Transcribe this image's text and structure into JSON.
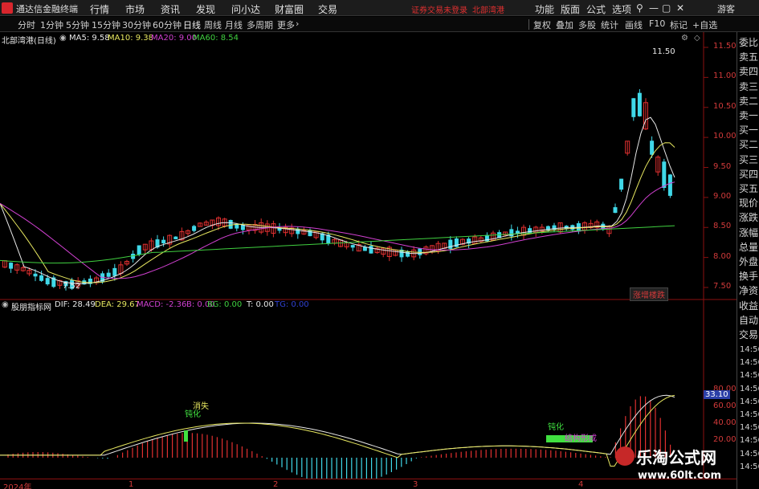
{
  "titlebar": {
    "app_name": "通达信金融终端",
    "menu": [
      "行情",
      "市场",
      "资讯",
      "发现",
      "问小达",
      "财富圈",
      "交易"
    ],
    "notice": "证券交易未登录",
    "stock_short": "北部湾港",
    "right_menu": [
      "功能",
      "版面",
      "公式",
      "选项"
    ],
    "guest": "游客"
  },
  "toolbar": {
    "periods": [
      "分时",
      "1分钟",
      "5分钟",
      "15分钟",
      "30分钟",
      "60分钟",
      "日线",
      "周线",
      "月线",
      "多周期",
      "更多"
    ],
    "active_period": "日线",
    "tools": [
      "复权",
      "叠加",
      "多股",
      "统计",
      "画线",
      "F10",
      "标记",
      "+自选"
    ]
  },
  "main_chart": {
    "title": "北部湾港(日线)",
    "ma_labels": [
      {
        "text": "MA5: 9.58",
        "color": "#e8e8e8"
      },
      {
        "text": "MA10: 9.38",
        "color": "#e8e860"
      },
      {
        "text": "MA20: 9.00",
        "color": "#d040d0"
      },
      {
        "text": "MA60: 8.54",
        "color": "#40d040"
      }
    ],
    "price_ticks": [
      "11.50",
      "11.00",
      "10.50",
      "10.00",
      "9.50",
      "9.00",
      "8.50",
      "8.00",
      "7.50"
    ],
    "high_label": "11.50",
    "low_label": "7.52",
    "tag": "涨增楼跌"
  },
  "sub_chart": {
    "title": "股朋指标网",
    "labels": [
      {
        "text": "DIF: 28.49",
        "color": "#e8e8e8"
      },
      {
        "text": "DEA: 29.67",
        "color": "#e8e860"
      },
      {
        "text": "MACD: -2.36",
        "color": "#d040d0"
      },
      {
        "text": "B: 0.00",
        "color": "#d040d0"
      },
      {
        "text": "BG: 0.00",
        "color": "#40d040"
      },
      {
        "text": "T: 0.00",
        "color": "#e8e8e8"
      },
      {
        "text": "TG: 0.00",
        "color": "#3040d0"
      }
    ],
    "ticks": [
      "80.00",
      "60.00",
      "40.00",
      "20.00"
    ],
    "value_box": "33.10",
    "annotations": [
      {
        "text": "消失",
        "color": "#e8e860"
      },
      {
        "text": "钝化",
        "color": "#40e040"
      },
      {
        "text": "钝化",
        "color": "#40e040"
      },
      {
        "text": "结构形成",
        "color": "#d040d0"
      }
    ]
  },
  "right_panel": {
    "labels": [
      "委比",
      "卖五",
      "卖四",
      "卖三",
      "卖二",
      "卖一",
      "买一",
      "买二",
      "买三",
      "买四",
      "买五",
      "现价",
      "涨跌",
      "涨幅",
      "总量",
      "外盘",
      "换手",
      "净资",
      "收益",
      "自动",
      "交易"
    ],
    "times": [
      "14:56",
      "14:56",
      "14:56",
      "14:56",
      "14:56",
      "14:56",
      "14:56",
      "14:56",
      "14:56",
      "14:56"
    ]
  },
  "x_axis": [
    "2024年",
    "1",
    "2",
    "3",
    "4"
  ],
  "watermark": {
    "title": "乐淘公式网",
    "url": "www.60lt.com"
  },
  "colors": {
    "up": "#e03030",
    "down": "#40d8e8",
    "ma5": "#e8e8e8",
    "ma10": "#e8e860",
    "ma20": "#d040d0",
    "ma60": "#40d040",
    "axis": "#8b1010"
  }
}
